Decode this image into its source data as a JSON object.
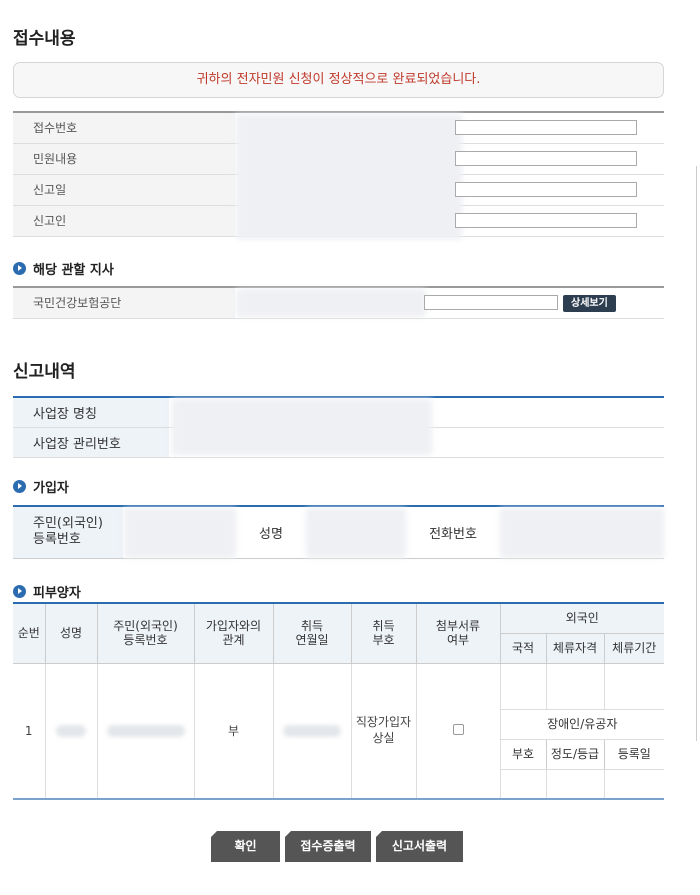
{
  "reception": {
    "title": "접수내용",
    "notice": "귀하의 전자민원 신청이 정상적으로 완료되었습니다.",
    "rows": [
      {
        "label": "접수번호"
      },
      {
        "label": "민원내용"
      },
      {
        "label": "신고일"
      },
      {
        "label": "신고인"
      }
    ]
  },
  "branch": {
    "title": "해당 관할 지사",
    "label": "국민건강보험공단",
    "detail_button": "상세보기"
  },
  "report": {
    "title": "신고내역",
    "rows": [
      {
        "label": "사업장 명칭"
      },
      {
        "label": "사업장 관리번호"
      }
    ]
  },
  "subscriber": {
    "title": "가입자",
    "id_label_line1": "주민(외국인)",
    "id_label_line2": "등록번호",
    "name_label": "성명",
    "phone_label": "전화번호"
  },
  "dependents": {
    "title": "피부양자",
    "headers": {
      "seq": "순번",
      "name": "성명",
      "id_line1": "주민(외국인)",
      "id_line2": "등록번호",
      "relation_line1": "가입자와의",
      "relation_line2": "관계",
      "acq_date_line1": "취득",
      "acq_date_line2": "연월일",
      "acq_code_line1": "취득",
      "acq_code_line2": "부호",
      "attach_line1": "첨부서류",
      "attach_line2": "여부",
      "foreigner": "외국인",
      "nationality": "국적",
      "stay_status": "체류자격",
      "stay_period": "체류기간",
      "disabled": "장애인/유공자",
      "code": "부호",
      "grade": "정도/등급",
      "reg_date": "등록일"
    },
    "row": {
      "seq": "1",
      "relation": "부",
      "acq_code_line1": "직장가입자",
      "acq_code_line2": "상실"
    }
  },
  "buttons": {
    "confirm": "확인",
    "print_receipt": "접수증출력",
    "print_report": "신고서출력"
  }
}
